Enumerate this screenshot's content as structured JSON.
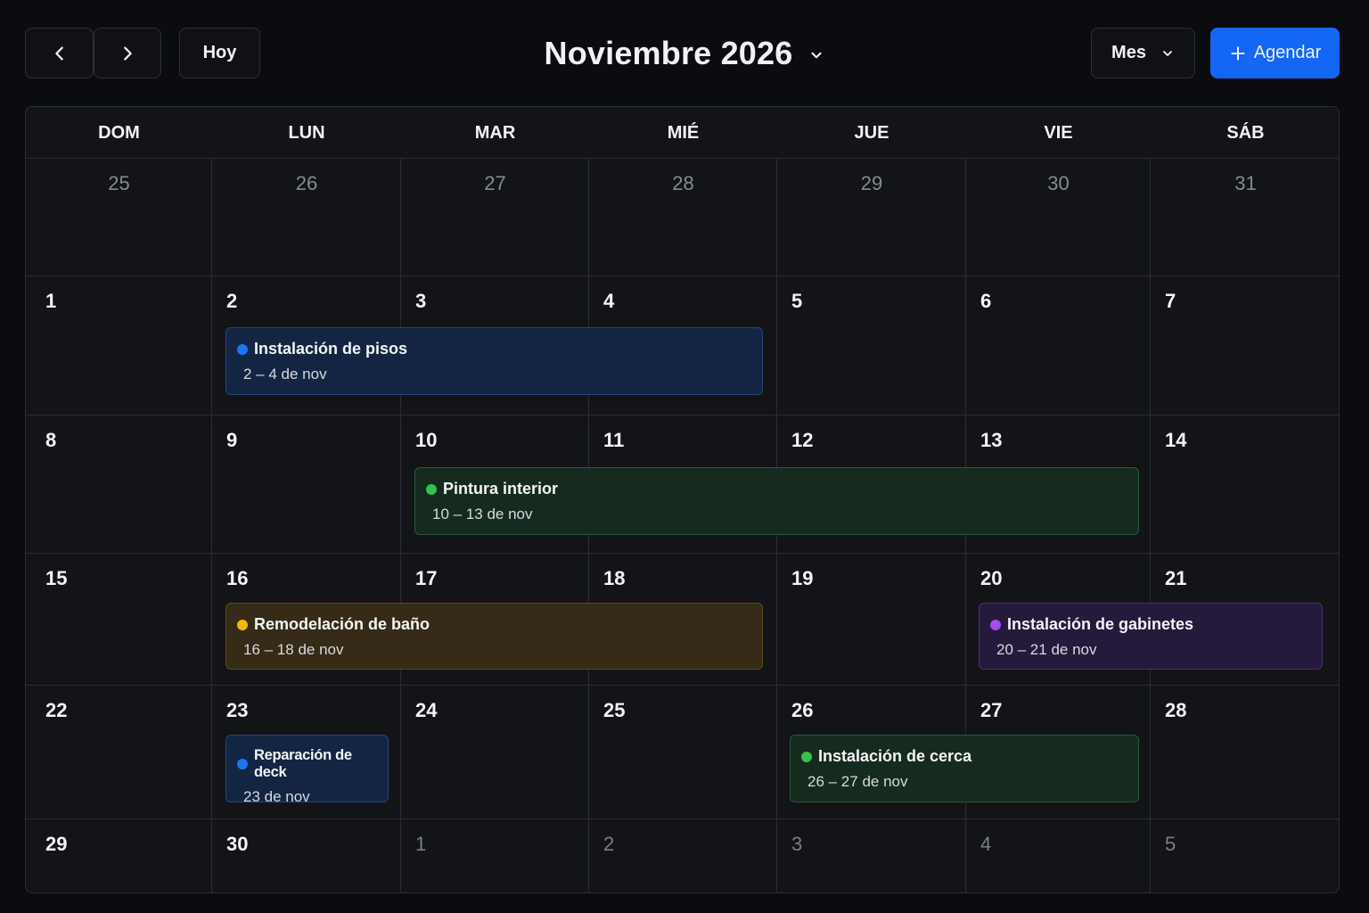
{
  "toolbar": {
    "today_label": "Hoy",
    "month_title": "Noviembre 2026",
    "view_label": "Mes",
    "schedule_label": "Agendar",
    "icons": {
      "prev": "chevron-left-icon",
      "next": "chevron-right-icon",
      "title_dropdown": "chevron-down-icon",
      "view_dropdown": "chevron-down-icon",
      "schedule": "plus-icon"
    }
  },
  "weekdays": [
    "DOM",
    "LUN",
    "MAR",
    "MIÉ",
    "JUE",
    "VIE",
    "SÁB"
  ],
  "weeks": [
    [
      {
        "d": "25",
        "muted": true
      },
      {
        "d": "26",
        "muted": true
      },
      {
        "d": "27",
        "muted": true
      },
      {
        "d": "28",
        "muted": true
      },
      {
        "d": "29",
        "muted": true
      },
      {
        "d": "30",
        "muted": true
      },
      {
        "d": "31",
        "muted": true
      }
    ],
    [
      {
        "d": "1"
      },
      {
        "d": "2"
      },
      {
        "d": "3"
      },
      {
        "d": "4"
      },
      {
        "d": "5"
      },
      {
        "d": "6"
      },
      {
        "d": "7"
      }
    ],
    [
      {
        "d": "8"
      },
      {
        "d": "9"
      },
      {
        "d": "10"
      },
      {
        "d": "11"
      },
      {
        "d": "12"
      },
      {
        "d": "13"
      },
      {
        "d": "14"
      }
    ],
    [
      {
        "d": "15"
      },
      {
        "d": "16"
      },
      {
        "d": "17"
      },
      {
        "d": "18"
      },
      {
        "d": "19"
      },
      {
        "d": "20"
      },
      {
        "d": "21"
      }
    ],
    [
      {
        "d": "22"
      },
      {
        "d": "23"
      },
      {
        "d": "24"
      },
      {
        "d": "25"
      },
      {
        "d": "26"
      },
      {
        "d": "27"
      },
      {
        "d": "28"
      }
    ],
    [
      {
        "d": "29"
      },
      {
        "d": "30"
      },
      {
        "d": "1",
        "muted": true
      },
      {
        "d": "2",
        "muted": true
      },
      {
        "d": "3",
        "muted": true
      },
      {
        "d": "4",
        "muted": true
      },
      {
        "d": "5",
        "muted": true
      }
    ]
  ],
  "events": [
    {
      "title": "Instalación de pisos",
      "range": "2 – 4 de nov",
      "color": "blue",
      "dot": "#1f74f5"
    },
    {
      "title": "Pintura interior",
      "range": "10 – 13 de nov",
      "color": "green",
      "dot": "#35c24a"
    },
    {
      "title": "Remodelación de baño",
      "range": "16 – 18 de nov",
      "color": "yellow",
      "dot": "#f2b80d"
    },
    {
      "title": "Instalación de gabinetes",
      "range": "20 – 21 de nov",
      "color": "purple",
      "dot": "#a24df0"
    },
    {
      "title": "Reparación de deck",
      "range": "23 de nov",
      "color": "blue",
      "dot": "#1f74f5"
    },
    {
      "title": "Instalación de cerca",
      "range": "26 – 27 de nov",
      "color": "green",
      "dot": "#35c24a"
    }
  ],
  "colors": {
    "accent": "#1466f5",
    "background": "#0b0c10",
    "grid": "#131417",
    "border": "#2a2d33"
  }
}
